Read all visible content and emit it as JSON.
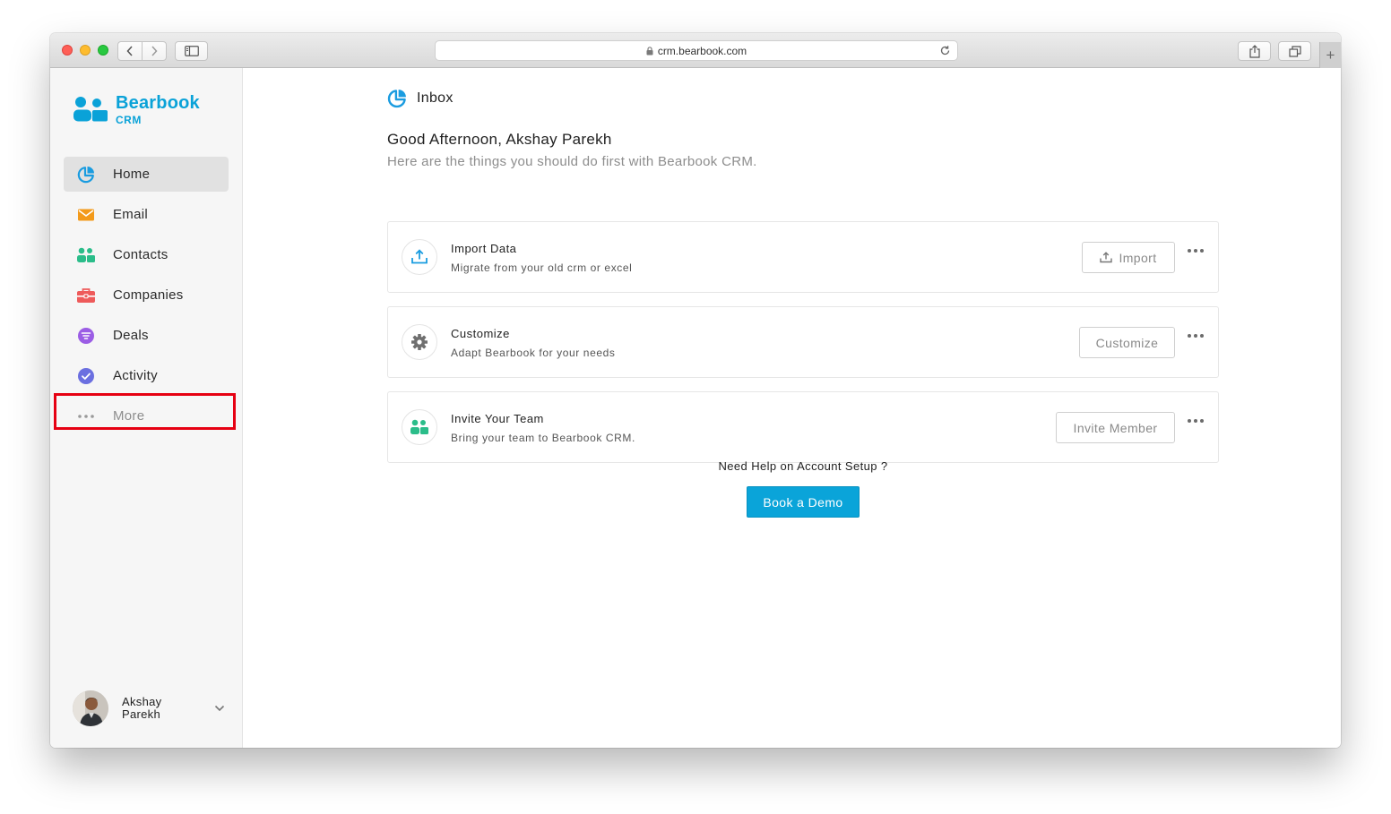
{
  "browser": {
    "url": "crm.bearbook.com",
    "new_tab_label": "+"
  },
  "brand": {
    "name": "Bearbook",
    "sub": "CRM",
    "color": "#0aa2d8"
  },
  "sidebar": {
    "items": [
      {
        "label": "Home",
        "icon": "home-pie-icon",
        "active": true
      },
      {
        "label": "Email",
        "icon": "email-icon"
      },
      {
        "label": "Contacts",
        "icon": "contacts-icon"
      },
      {
        "label": "Companies",
        "icon": "briefcase-icon"
      },
      {
        "label": "Deals",
        "icon": "deals-filter-icon"
      },
      {
        "label": "Activity",
        "icon": "check-circle-icon",
        "highlighted": true
      },
      {
        "label": "More",
        "icon": "ellipsis-icon"
      }
    ],
    "highlight_color": "#e60012"
  },
  "user": {
    "first_name": "Akshay",
    "last_name": "Parekh"
  },
  "main": {
    "title": "Inbox",
    "greeting": "Good Afternoon, Akshay Parekh",
    "subtitle": "Here are the things you should do first with Bearbook CRM.",
    "tasks": [
      {
        "title": "Import Data",
        "desc": "Migrate from your old crm or excel",
        "button": "Import",
        "icon": "upload-icon"
      },
      {
        "title": "Customize",
        "desc": "Adapt Bearbook for your needs",
        "button": "Customize",
        "icon": "gear-icon"
      },
      {
        "title": "Invite Your Team",
        "desc": "Bring your team to Bearbook CRM.",
        "button": "Invite Member",
        "icon": "team-icon"
      }
    ],
    "help_text": "Need Help on Account Setup ?",
    "demo_button": "Book a Demo",
    "demo_color": "#0aa4d9"
  }
}
